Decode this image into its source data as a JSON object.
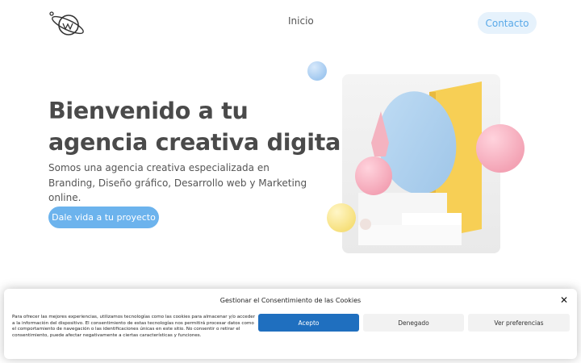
{
  "header": {
    "logo_icon": "planet-logo-icon",
    "nav_inicio": "Inicio",
    "contact_label": "Contacto"
  },
  "hero": {
    "title_line1": "Bienvenido a tu",
    "title_line2": "agencia creativa digital",
    "subtitle": "Somos una agencia creativa especializada en Branding, Diseño gráfico, Desarrollo web y Marketing online.",
    "cta_label": "Dale vida a tu proyecto"
  },
  "cookie": {
    "title": "Gestionar el Consentimiento de las Cookies",
    "text": "Para ofrecer las mejores experiencias, utilizamos tecnologías como las cookies para almacenar y/o acceder a la información del dispositivo. El consentimiento de estas tecnologías nos permitirá procesar datos como el comportamiento de navegación o las identificaciones únicas en este sitio. No consentir o retirar el consentimiento, puede afectar negativamente a ciertas características y funciones.",
    "accept_label": "Acepto",
    "deny_label": "Denegado",
    "prefs_label": "Ver preferencias",
    "close_icon": "close-icon"
  },
  "colors": {
    "accent": "#6cb3ed",
    "contact_bg": "#e6f2fc",
    "accept_bg": "#1f6fbf"
  }
}
